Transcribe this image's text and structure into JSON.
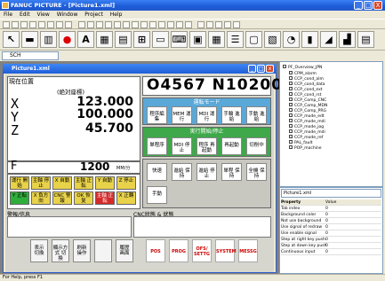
{
  "window": {
    "title": "FANUC PICTURE - [Picture1.xml]",
    "min": "_",
    "max": "□",
    "close": "X"
  },
  "menu": [
    "File",
    "Edit",
    "View",
    "Window",
    "Project",
    "Help"
  ],
  "combo": "SCH",
  "inner": {
    "title": "Picture1.xml"
  },
  "cnc": {
    "pos_title": "現在位置",
    "pos_sub": "(絶対座標)",
    "axes": [
      {
        "name": "X",
        "value": "123.000"
      },
      {
        "name": "Y",
        "value": "100.000"
      },
      {
        "name": "Z",
        "value": "45.700"
      }
    ],
    "feed_label": "F",
    "feed_value": "1200",
    "feed_unit": "MM/分",
    "program": "O4567 N10200",
    "mode_title": "運転モード",
    "mode_buttons": [
      "程序編集",
      "MEM 運行",
      "MDI 運行",
      "手輪 進給",
      "手動 進給"
    ],
    "exec_title": "実行開始/停止",
    "exec_buttons": [
      "単程序",
      "MDI 停止",
      "程序 再起動",
      "再起動",
      "切削中"
    ],
    "misc_buttons": [
      "快速",
      "進給 保持",
      "進給 停止",
      "単程 保持",
      "全機 保持"
    ],
    "manual_btn": "手動",
    "sw_buttons": [
      "運行 開始",
      "主軸 停止",
      "X 自動",
      "主軸 正転",
      "Y 自動",
      "Z 停止",
      "Y 正転",
      "X 負方向",
      "CNC 警報",
      "OK 恢复",
      "主軸 正転",
      "X 正轉"
    ],
    "alarm_title": "警報/信息",
    "status_title": "CNC狀態 & 狀態",
    "fkeys": [
      "表示 切換",
      "顯示方式 切換",
      "刷新 操作",
      "",
      "履歴 画面"
    ],
    "fkeys_red": [
      "POS",
      "PROG",
      "OFS/ SETTG",
      "SYSTEM",
      "MESSG"
    ]
  },
  "tree": {
    "root": "PF_Overview_JPN",
    "items": [
      "CPM_alarm",
      "CCP_cond_alm",
      "CCP_cond_data",
      "CCP_cond_ext",
      "CCP_cond_rst",
      "CCP_Comp_CNC",
      "CCP_Comp_MDN",
      "CCP_Comp_PRG",
      "CCP_mode_edt",
      "CCP_mode_mdi",
      "CCP_mode_jog",
      "CCP_mode_mdi",
      "CCP_mode_ref",
      "PAL_fault",
      "POP_machine"
    ]
  },
  "props": {
    "selected": "Picture1.xml",
    "header": [
      "Property",
      "Value"
    ],
    "rows": [
      [
        "Tab index",
        "0"
      ],
      [
        "Background color",
        "0"
      ],
      [
        "Not use background",
        "0"
      ],
      [
        "Use signal of redraw",
        "0"
      ],
      [
        "Use enable signal",
        "0"
      ],
      [
        "Step at right key push",
        "0"
      ],
      [
        "Step at down key push",
        "0"
      ],
      [
        "Continuous input",
        "0"
      ]
    ]
  },
  "statusbar": "For Help, press F1"
}
